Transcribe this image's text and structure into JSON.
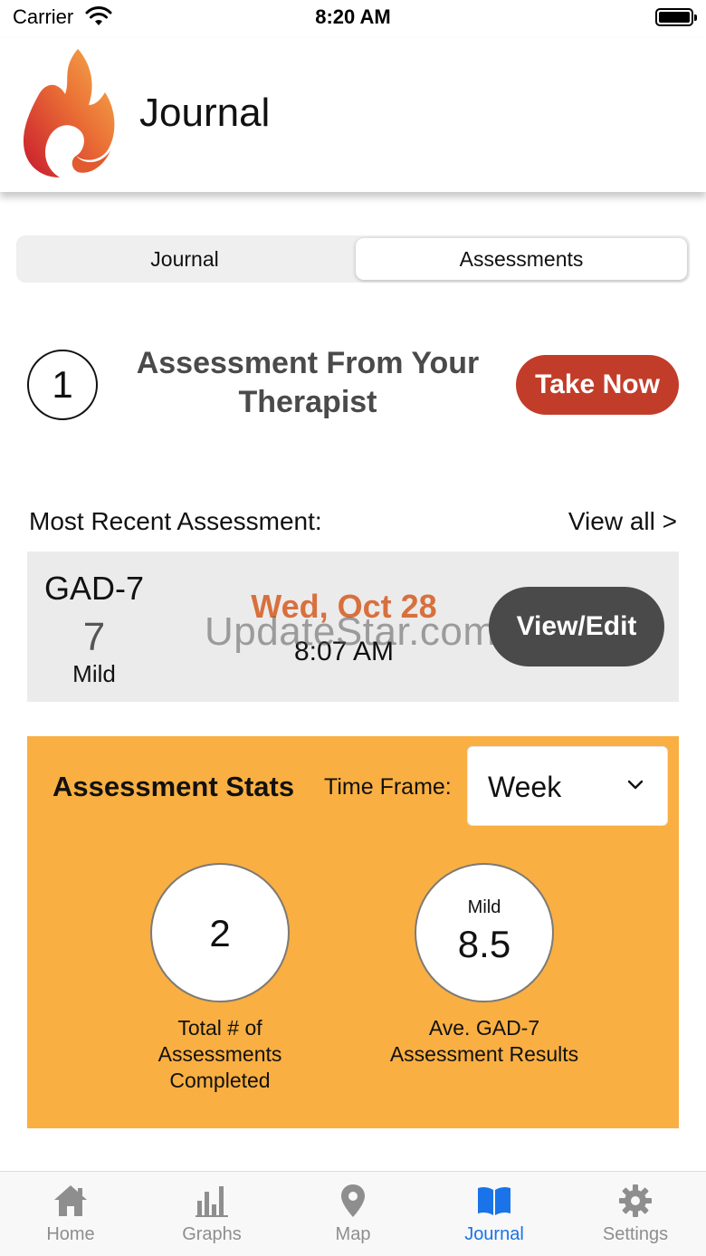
{
  "status_bar": {
    "carrier": "Carrier",
    "time": "8:20 AM"
  },
  "header": {
    "title": "Journal",
    "logo_icon": "flame-logo-icon"
  },
  "segmented": {
    "tab1": "Journal",
    "tab2": "Assessments",
    "selected": "Assessments"
  },
  "assignment": {
    "count": "1",
    "text": "Assessment From Your Therapist",
    "button": "Take Now"
  },
  "recent": {
    "label": "Most Recent Assessment:",
    "view_all": "View all >",
    "type": "GAD-7",
    "score": "7",
    "severity": "Mild",
    "date": "Wed, Oct 28",
    "time": "8:07 AM",
    "button": "View/Edit",
    "watermark": "UpdateStar.com"
  },
  "stats": {
    "title": "Assessment Stats",
    "timeframe_label": "Time Frame:",
    "timeframe_value": "Week",
    "total_value": "2",
    "total_caption": "Total # of Assessments Completed",
    "avg_label": "Mild",
    "avg_value": "8.5",
    "avg_caption": "Ave. GAD-7 Assessment Results"
  },
  "tabbar": [
    {
      "label": "Home",
      "icon": "home-icon"
    },
    {
      "label": "Graphs",
      "icon": "bar-chart-icon"
    },
    {
      "label": "Map",
      "icon": "map-pin-icon"
    },
    {
      "label": "Journal",
      "icon": "book-icon",
      "active": true
    },
    {
      "label": "Settings",
      "icon": "gear-icon"
    }
  ],
  "colors": {
    "accent_red": "#c13d2a",
    "date_orange": "#d8703e",
    "stats_bg": "#f9af42",
    "active_tab": "#1a73e8",
    "inactive_tab": "#8e8e8e"
  }
}
